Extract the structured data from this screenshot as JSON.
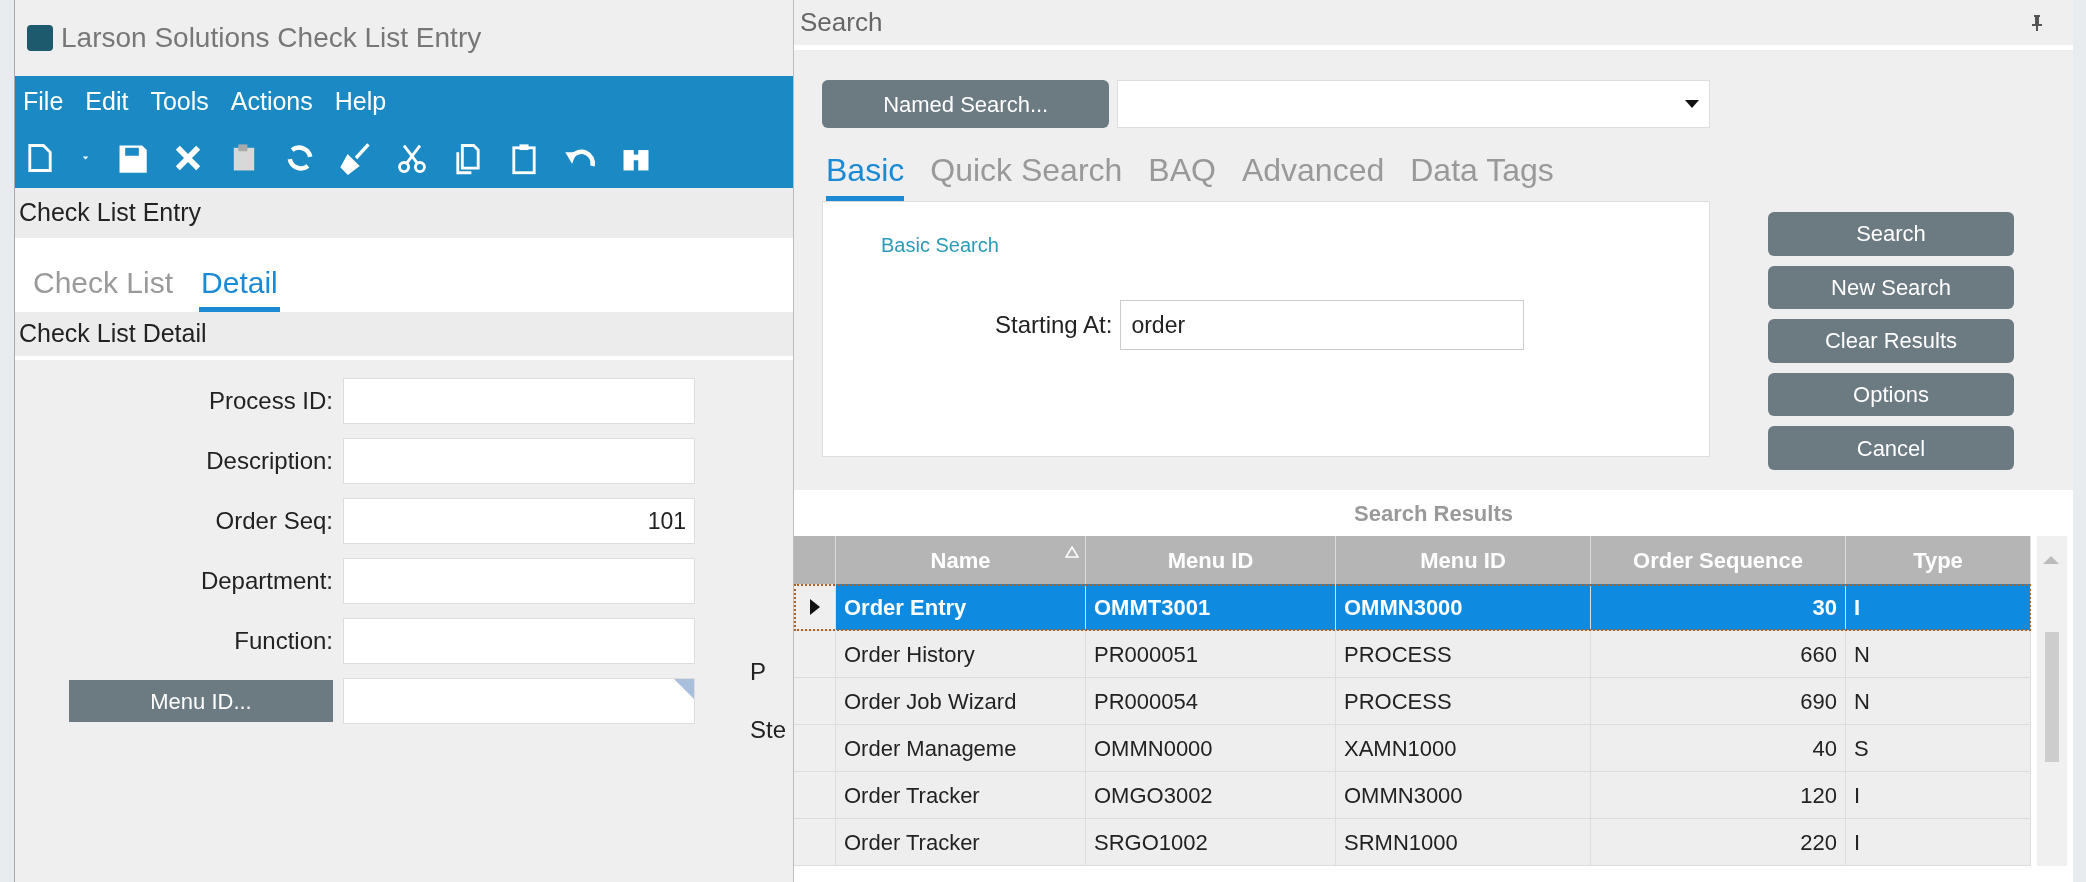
{
  "check_list_window": {
    "title": "Larson Solutions Check List Entry",
    "menu": [
      "File",
      "Edit",
      "Tools",
      "Actions",
      "Help"
    ],
    "header": "Check List Entry",
    "tabs": [
      {
        "label": "Check List",
        "selected": false
      },
      {
        "label": "Detail",
        "selected": true
      }
    ],
    "section": "Check List Detail",
    "fields": [
      {
        "kind": "text",
        "label": "Process ID:"
      },
      {
        "kind": "text",
        "label": "Description:"
      },
      {
        "kind": "text",
        "label": "Order Seq:",
        "value": "101"
      },
      {
        "kind": "text",
        "label": "Department:"
      },
      {
        "kind": "text",
        "label": "Function:"
      },
      {
        "kind": "button",
        "label": "Menu ID..."
      }
    ],
    "cut_labels": [
      "P",
      "Ste"
    ]
  },
  "search_window": {
    "title": "Search",
    "named_search_button": "Named Search...",
    "tabs": [
      {
        "label": "Basic",
        "selected": true
      },
      {
        "label": "Quick Search",
        "selected": false
      },
      {
        "label": "BAQ",
        "selected": false
      },
      {
        "label": "Advanced",
        "selected": false
      },
      {
        "label": "Data Tags",
        "selected": false
      }
    ],
    "panel_title": "Basic Search",
    "starting_at": {
      "label": "Starting At:",
      "value": "order"
    },
    "buttons": [
      "Search",
      "New Search",
      "Clear Results",
      "Options",
      "Cancel"
    ],
    "results": {
      "title": "Search Results",
      "columns": [
        {
          "label": "Name",
          "sorted": true
        },
        {
          "label": "Menu ID",
          "sorted": false
        },
        {
          "label": "Menu ID",
          "sorted": false
        },
        {
          "label": "Order Sequence",
          "sorted": false
        },
        {
          "label": "Type",
          "sorted": false
        }
      ],
      "rows": [
        {
          "selected": true,
          "cells": [
            "Order Entry",
            "OMMT3001",
            "OMMN3000",
            "30",
            "I"
          ]
        },
        {
          "selected": false,
          "cells": [
            "Order History",
            "PR000051",
            "PROCESS",
            "660",
            "N"
          ]
        },
        {
          "selected": false,
          "cells": [
            "Order Job Wizard",
            "PR000054",
            "PROCESS",
            "690",
            "N"
          ]
        },
        {
          "selected": false,
          "cells": [
            "Order Manageme",
            "OMMN0000",
            "XAMN1000",
            "40",
            "S"
          ]
        },
        {
          "selected": false,
          "cells": [
            "Order Tracker",
            "OMGO3002",
            "OMMN3000",
            "120",
            "I"
          ]
        },
        {
          "selected": false,
          "cells": [
            "Order Tracker",
            "SRGO1002",
            "SRMN1000",
            "220",
            "I"
          ]
        }
      ]
    }
  }
}
